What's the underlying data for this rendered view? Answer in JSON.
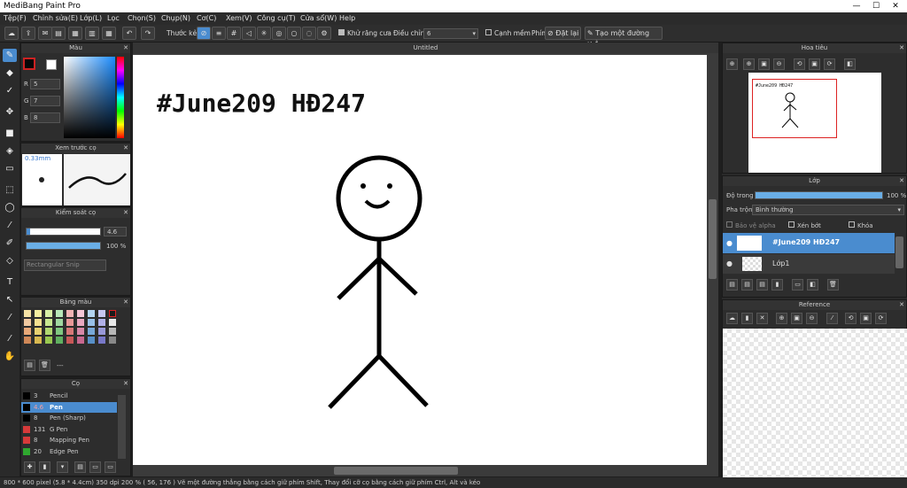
{
  "window": {
    "title": "MediBang Paint Pro",
    "min": "—",
    "max": "☐",
    "close": "✕"
  },
  "menu": [
    "Tệp(F)",
    "Chỉnh sửa(E)",
    "Lớp(L)",
    "Lọc",
    "Chọn(S)",
    "Chụp(N)",
    "Cơ(C)",
    "Xem(V)",
    "Công cụ(T)",
    "Cửa sổ(W)",
    "Help"
  ],
  "toolbar": {
    "ruler_label": "Thước kẻ",
    "antialias_label": "Khử răng cưa",
    "adjust_label": "Điều chỉnh",
    "adjust_value": "6",
    "smooth_label": "Cạnh mềm",
    "key_label": "Phím",
    "reset_label": "Đặt lại",
    "line_label": "Tạo một đường thẳng"
  },
  "color_panel": {
    "title": "Màu",
    "r_label": "R",
    "r_value": "5",
    "g_label": "G",
    "g_value": "7",
    "b_label": "B",
    "b_value": "8",
    "primary": "#050708"
  },
  "brush_preview": {
    "title": "Xem trước cọ",
    "size": "0.33mm"
  },
  "brush_control": {
    "title": "Kiểm soát cọ",
    "size_value": "4.6",
    "opacity_value": "100 %",
    "size_fill": 0.05,
    "opacity_fill": 1.0
  },
  "tooltip": "Rectangular Snip",
  "palette": {
    "title": "Bảng màu",
    "footer": "---"
  },
  "brushes": {
    "title": "Cọ",
    "items": [
      {
        "size": "3",
        "name": "Pencil",
        "color": "#000000"
      },
      {
        "size": "4.6",
        "name": "Pen",
        "color": "#000000",
        "selected": true
      },
      {
        "size": "8",
        "name": "Pen (Sharp)",
        "color": "#000000"
      },
      {
        "size": "131",
        "name": "G Pen",
        "color": "#d63a3a"
      },
      {
        "size": "8",
        "name": "Mapping Pen",
        "color": "#d63a3a"
      },
      {
        "size": "20",
        "name": "Edge Pen",
        "color": "#2fa82f"
      }
    ]
  },
  "canvas": {
    "tab": "Untitled",
    "text": "#June209 HĐ247"
  },
  "navigator": {
    "title": "Hoa tiêu",
    "thumb_text": "#June209 HĐ247"
  },
  "layers": {
    "title": "Lớp",
    "opacity_label": "Độ trong",
    "opacity_value": "100 %",
    "blend_label": "Pha trộn",
    "blend_value": "Bình thường",
    "protect_alpha": "Bảo vệ alpha",
    "clipping": "Xén bớt",
    "lock": "Khóa",
    "items": [
      {
        "name": "#June209 HĐ247",
        "selected": true
      },
      {
        "name": "Lớp1",
        "selected": false
      }
    ]
  },
  "reference": {
    "title": "Reference"
  },
  "status": "800 * 600 pixel   (5.8 * 4.4cm)   350 dpi   200 %   ( 56, 176 )   Vẽ một đường thẳng bằng cách giữ phím Shift, Thay đổi cỡ cọ bằng cách giữ phím Ctrl, Alt và kéo"
}
